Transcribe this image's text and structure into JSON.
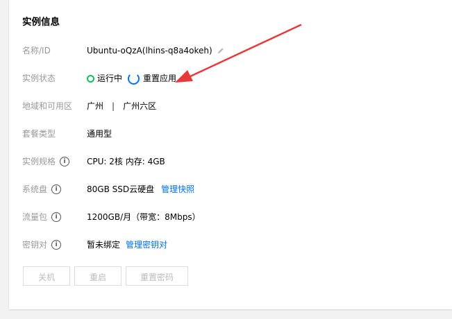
{
  "section_title": "实例信息",
  "rows": [
    {
      "label": "名称/ID",
      "value": "Ubuntu-oQzA(lhins-q8a4okeh)"
    },
    {
      "label": "实例状态",
      "status": "运行中",
      "task": "重置应用"
    },
    {
      "label": "地域和可用区",
      "region": "广州",
      "separator": "|",
      "zone": "广州六区"
    },
    {
      "label": "套餐类型",
      "value": "通用型"
    },
    {
      "label": "实例规格",
      "value": "CPU: 2核 内存: 4GB"
    },
    {
      "label": "系统盘",
      "value": "80GB SSD云硬盘",
      "link": "管理快照"
    },
    {
      "label": "流量包",
      "value": "1200GB/月（带宽：8Mbps）"
    },
    {
      "label": "密钥对",
      "value": "暂未绑定",
      "link": "管理密钥对"
    }
  ],
  "buttons": {
    "shutdown": "关机",
    "restart": "重启",
    "reset_password": "重置密码"
  },
  "colors": {
    "running": "#0abf5b",
    "link": "#006eff",
    "annotation_arrow": "#e8393a"
  },
  "icons": {
    "edit": "pencil-icon",
    "info": "info-circle-icon",
    "loading": "spinner-icon",
    "status": "status-ring-icon"
  }
}
